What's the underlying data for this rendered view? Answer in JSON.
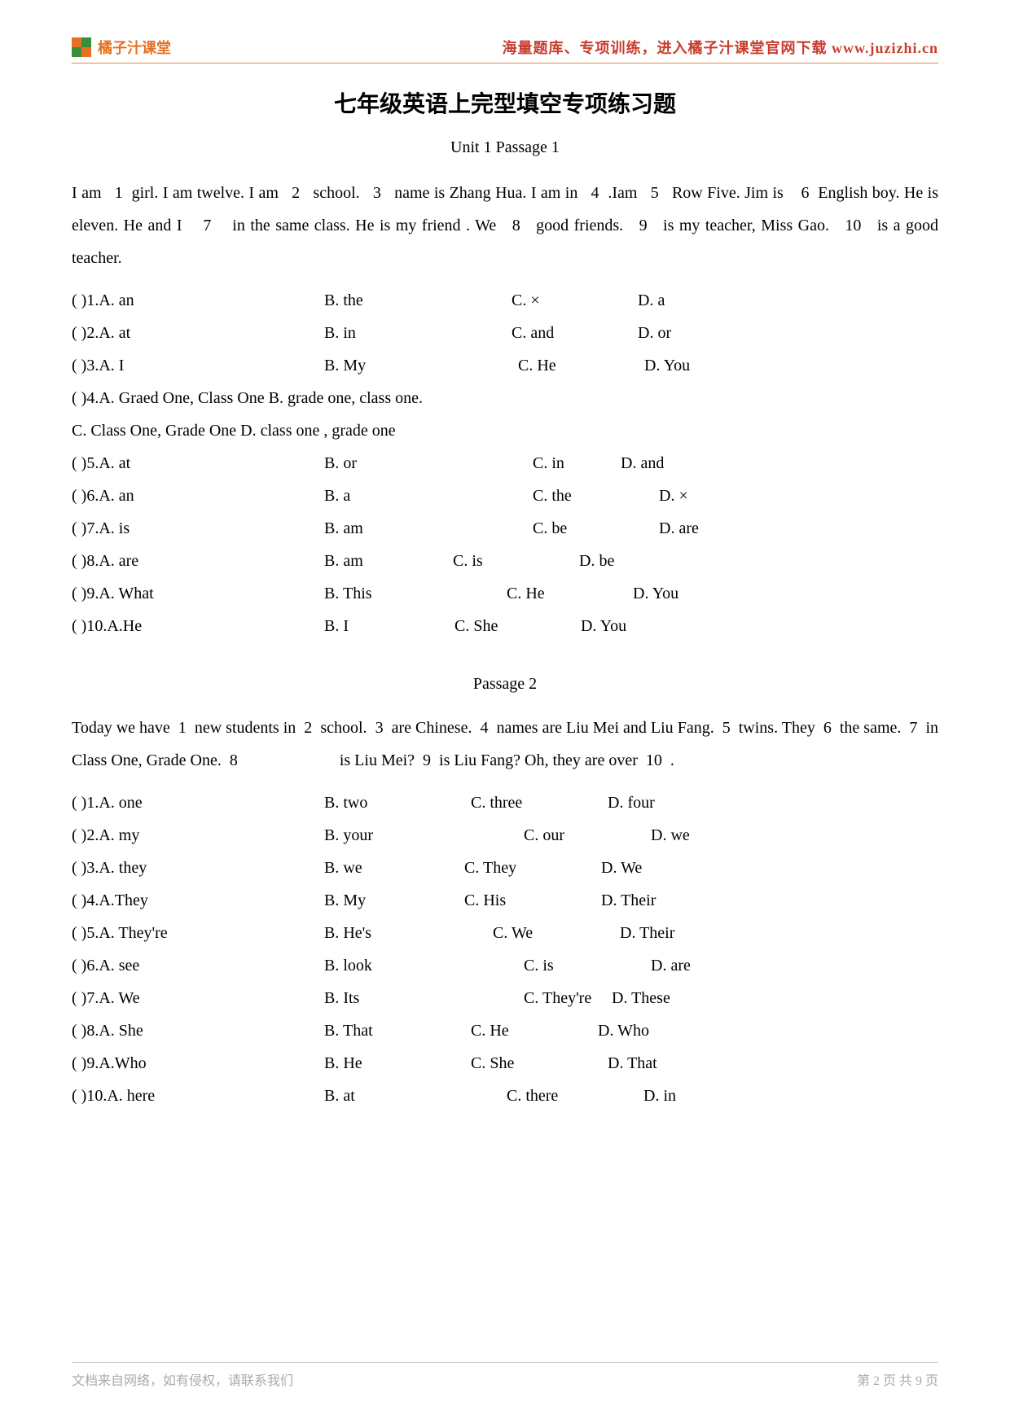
{
  "header": {
    "logo_text": "橘子汁课堂",
    "link_text": "海量题库、专项训练，进入橘子汁课堂官网下载 www.juzizhi.cn"
  },
  "main_title": "七年级英语上完型填空专项练习题",
  "sub_title": "Unit 1    Passage  1",
  "passage1_html": "I am   1  girl. I am twelve. I am   2   school.   3   name is Zhang Hua. I am in   4  .Iam   5   Row Five. Jim is    6  English boy. He is eleven. He and I    7    in the same class. He is my friend . We   8   good friends.   9   is my teacher, Miss Gao.   10   is a good teacher.",
  "p1q": [
    {
      "n": "(     )1.A. an",
      "b": "B. the",
      "c": "C. ×",
      "d": "D. a",
      "bl": 230,
      "cl": 155,
      "dl": 95
    },
    {
      "n": "(     )2.A. at",
      "b": "B. in",
      "c": "C. and",
      "d": "D. or",
      "bl": 230,
      "cl": 155,
      "dl": 155
    },
    {
      "n": "(     )3.A. I",
      "b": "B. My",
      "c": "C. He",
      "d": "D. You",
      "bl": 238,
      "cl": 155,
      "dl": 155
    },
    {
      "full": "(     )4.A. Graed One,  Class One     B. grade one, class one."
    },
    {
      "full": "C. Class One, Grade One  D. class one , grade one"
    },
    {
      "n": "(     )5.A. at",
      "b": "B. or",
      "c": "C. in",
      "d": "D. and",
      "bl": 256,
      "cl": 108,
      "dl": 205
    },
    {
      "n": "(     )6.A. an",
      "b": "B. a",
      "c": "C. the",
      "d": "D. ×",
      "bl": 256,
      "cl": 155,
      "dl": 148
    },
    {
      "n": "(     )7.A. is",
      "b": "B. am",
      "c": "C. be",
      "d": "D. are",
      "bl": 256,
      "cl": 155,
      "dl": 148
    },
    {
      "n": "(     )8.A. are",
      "b": "B. am",
      "c": "C. is",
      "d": "D. be",
      "bl": 158,
      "cl": 155,
      "dl": 155
    },
    {
      "n": "(     )9.A. What",
      "b": "B. This",
      "c": "C. He",
      "d": "D. You",
      "bl": 224,
      "cl": 155,
      "dl": 155
    },
    {
      "n": "(     )10.A.He",
      "b": "B. I",
      "c": "C. She",
      "d": "D. You",
      "bl": 160,
      "cl": 155,
      "dl": 155
    }
  ],
  "passage2_title": "Passage  2",
  "passage2_html": "Today we have  1  new students in  2  school.  3  are Chinese.  4  names are Liu Mei and Liu Fang.  5  twins. They  6  the same.  7  in Class One, Grade One.  8                         is Liu Mei?  9  is Liu Fang? Oh, they are over  10  .",
  "p2q": [
    {
      "n": "(     )1.A. one",
      "b": "B. two",
      "c": "C. three",
      "d": "D. four",
      "bl": 180,
      "cl": 168,
      "dl": 145
    },
    {
      "n": "(     )2.A. my",
      "b": "B. your",
      "c": "C. our",
      "d": "D. we",
      "bl": 245,
      "cl": 156,
      "dl": 156
    },
    {
      "n": "(     )3.A. they",
      "b": "B. we",
      "c": "C. They",
      "d": "D. We",
      "bl": 172,
      "cl": 168,
      "dl": 145
    },
    {
      "n": "(     )4.A.They",
      "b": "B. My",
      "c": "C. His",
      "d": "D. Their",
      "bl": 172,
      "cl": 168,
      "dl": 168
    },
    {
      "n": "(     )5.A. They're",
      "b": "B. He's",
      "c": "C. We",
      "d": "D. Their",
      "bl": 207,
      "cl": 156,
      "dl": 168
    },
    {
      "n": "(     )6.A. see",
      "b": "B. look",
      "c": "C. is",
      "d": "D. are",
      "bl": 245,
      "cl": 156,
      "dl": 185
    },
    {
      "n": "(     )7.A. We",
      "b": "B. Its",
      "c": "C. They're",
      "d": "D. These",
      "bl": 245,
      "cl": 108,
      "dl": 135
    },
    {
      "n": "(     )8.A. She",
      "b": "B. That",
      "c": "C. He",
      "d": "D. Who",
      "bl": 180,
      "cl": 156,
      "dl": 168
    },
    {
      "n": "(     )9.A.Who",
      "b": "B. He",
      "c": "C. She",
      "d": "D. That",
      "bl": 180,
      "cl": 168,
      "dl": 168
    },
    {
      "n": "(     )10.A. here",
      "b": "B. at",
      "c": "C. there",
      "d": "D. in",
      "bl": 224,
      "cl": 168,
      "dl": 148
    }
  ],
  "footer": {
    "left": "文档来自网络，如有侵权，请联系我们",
    "right": "第 2 页 共 9 页"
  }
}
